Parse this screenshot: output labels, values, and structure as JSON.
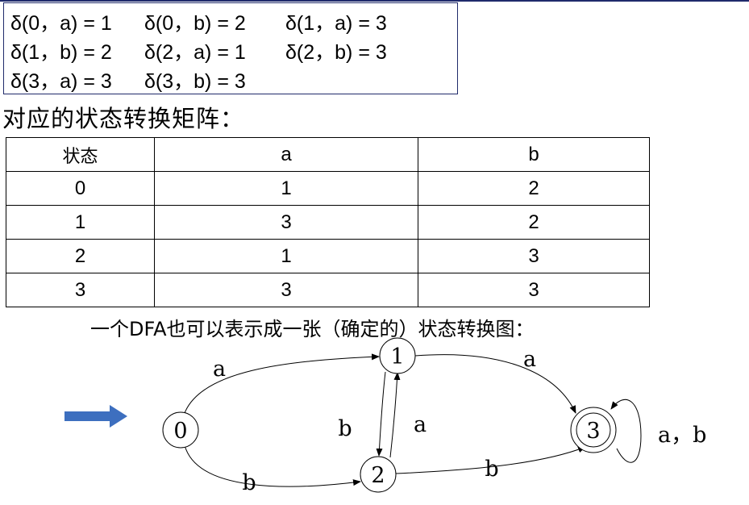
{
  "transitions": [
    [
      "δ(0，a) = 1",
      "δ(0，b) = 2",
      "δ(1，a) = 3"
    ],
    [
      "δ(1，b) = 2",
      "δ(2，a) = 1",
      "δ(2，b) = 3"
    ],
    [
      "δ(3，a) = 3",
      "δ(3，b) = 3",
      ""
    ]
  ],
  "matrix_caption": "对应的状态转换矩阵：",
  "matrix": {
    "headers": [
      "状态",
      "a",
      "b"
    ],
    "rows": [
      [
        "0",
        "1",
        "2"
      ],
      [
        "1",
        "3",
        "2"
      ],
      [
        "2",
        "1",
        "3"
      ],
      [
        "3",
        "3",
        "3"
      ]
    ]
  },
  "dfa_caption": "一个DFA也可以表示成一张（确定的）状态转换图：",
  "diagram": {
    "start_arrow_color": "#3d6fbf",
    "states": [
      {
        "id": "0",
        "label": "0",
        "accepting": false,
        "start": true
      },
      {
        "id": "1",
        "label": "1",
        "accepting": false,
        "start": false
      },
      {
        "id": "2",
        "label": "2",
        "accepting": false,
        "start": false
      },
      {
        "id": "3",
        "label": "3",
        "accepting": true,
        "start": false
      }
    ],
    "edges": [
      {
        "from": "0",
        "to": "1",
        "label": "a"
      },
      {
        "from": "0",
        "to": "2",
        "label": "b"
      },
      {
        "from": "1",
        "to": "2",
        "label": "b"
      },
      {
        "from": "2",
        "to": "1",
        "label": "a"
      },
      {
        "from": "1",
        "to": "3",
        "label": "a"
      },
      {
        "from": "2",
        "to": "3",
        "label": "b"
      },
      {
        "from": "3",
        "to": "3",
        "label": "a，b"
      }
    ]
  }
}
